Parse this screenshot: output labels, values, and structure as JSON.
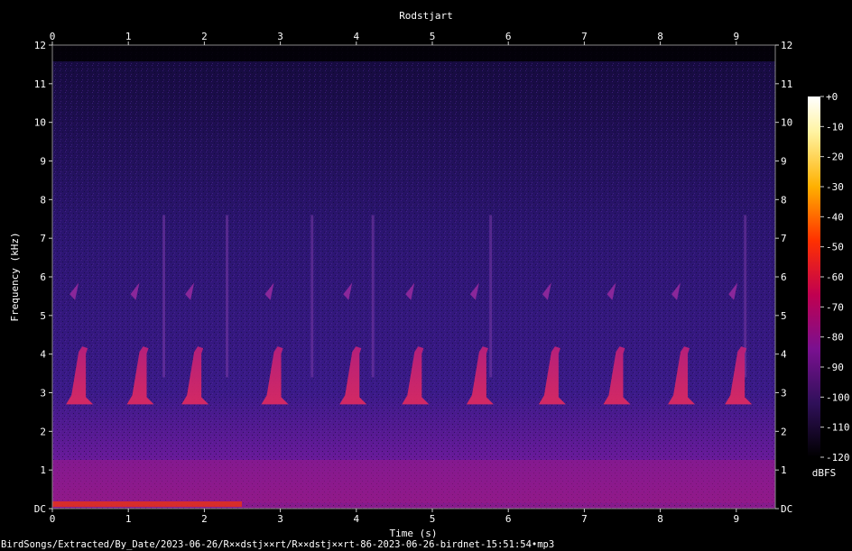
{
  "chart_data": {
    "type": "heatmap",
    "title": "Rodstjart",
    "xlabel": "Time (s)",
    "ylabel": "Frequency (kHz)",
    "x_ticks": [
      "0",
      "1",
      "2",
      "3",
      "4",
      "5",
      "6",
      "7",
      "8",
      "9"
    ],
    "y_ticks": [
      "DC",
      "1",
      "2",
      "3",
      "4",
      "5",
      "6",
      "7",
      "8",
      "9",
      "10",
      "11",
      "12"
    ],
    "xlim": [
      0,
      9.5
    ],
    "ylim": [
      0,
      12
    ],
    "colorbar": {
      "label": "dBFS",
      "ticks": [
        "+0",
        "-10",
        "-20",
        "-30",
        "-40",
        "-50",
        "-60",
        "-70",
        "-80",
        "-90",
        "-100",
        "-110",
        "-120"
      ],
      "range": [
        -120,
        0
      ]
    },
    "notes_start_s": [
      0.18,
      0.98,
      1.7,
      2.75,
      3.78,
      4.6,
      5.45,
      6.4,
      7.25,
      8.1,
      8.85
    ],
    "note_freq_khz": [
      2.7,
      4.2
    ],
    "faint_vertical_streaks_s": [
      1.45,
      2.28,
      3.4,
      4.2,
      5.75,
      9.1
    ],
    "footer": "BirdSongs/Extracted/By_Date/2023-06-26/R××dstj××rt/R××dstj××rt-86-2023-06-26-birdnet-15:51:54•mp3"
  }
}
